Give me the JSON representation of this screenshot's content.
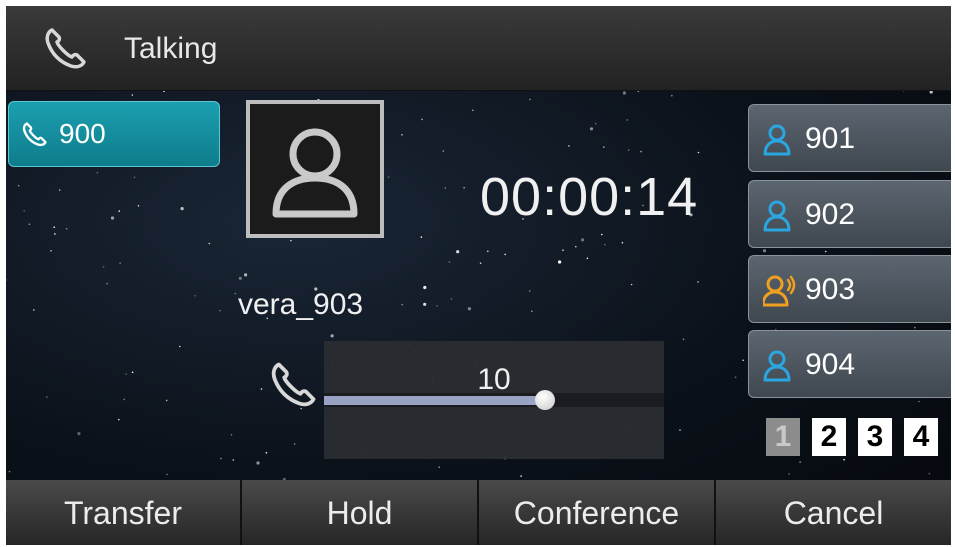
{
  "status_bar": {
    "title": "Talking",
    "icon": "handset-icon"
  },
  "line_key": {
    "label": "900",
    "icon": "handset-icon",
    "color": "#13919f"
  },
  "call": {
    "timer": "00:00:14",
    "caller": "vera_903"
  },
  "volume": {
    "value": "10",
    "level_fraction": 0.65,
    "icon": "handset-icon"
  },
  "blf_keys": [
    {
      "label": "901",
      "icon": "contact-idle-icon",
      "color": "#2aa7e0"
    },
    {
      "label": "902",
      "icon": "contact-idle-icon",
      "color": "#2aa7e0"
    },
    {
      "label": "903",
      "icon": "contact-talking-icon",
      "color": "#f0a020"
    },
    {
      "label": "904",
      "icon": "contact-idle-icon",
      "color": "#2aa7e0"
    }
  ],
  "pages": {
    "items": [
      "1",
      "2",
      "3",
      "4"
    ],
    "active_index": 0
  },
  "softkeys": [
    "Transfer",
    "Hold",
    "Conference",
    "Cancel"
  ]
}
